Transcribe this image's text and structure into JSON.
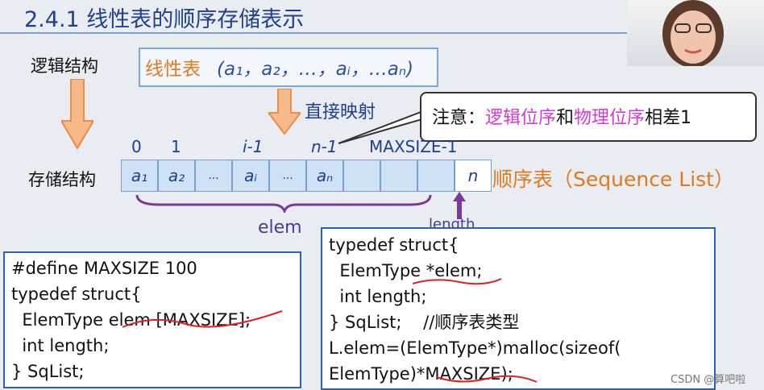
{
  "title": "2.4.1 线性表的顺序存储表示",
  "labels": {
    "logical": "逻辑结构",
    "storage": "存储结构",
    "direct_map": "直接映射"
  },
  "linear_table": {
    "title": "线性表",
    "sequence": "(a₁，a₂，…，aᵢ，…aₙ)"
  },
  "callout": {
    "prefix": "注意：",
    "hl1": "逻辑位序",
    "mid": "和",
    "hl2": "物理位序",
    "suffix": "相差1"
  },
  "indices": [
    "0",
    "1",
    "i-1",
    "n-1",
    "MAXSIZE-1"
  ],
  "cells": [
    "a₁",
    "a₂",
    "...",
    "aᵢ",
    "...",
    "aₙ",
    "",
    "",
    "",
    "n"
  ],
  "sequence_table_label": "顺序表（Sequence List）",
  "elem_label": "elem",
  "length_label": "length",
  "code_left": [
    "#define MAXSIZE 100",
    "typedef struct{",
    "  ElemType elem [MAXSIZE];",
    "  int length;",
    "} SqList;"
  ],
  "code_right": [
    "typedef struct{",
    "  ElemType *elem;",
    "  int length;",
    "} SqList;    //顺序表类型",
    "L.elem=(ElemType*)malloc(sizeof(",
    "ElemType)*MAXSIZE);"
  ],
  "watermark": "CSDN @算吧啦",
  "colors": {
    "title": "#1f3f8f",
    "orange": "#e07a20",
    "magenta": "#d23ad1",
    "code_border": "#2b63ad",
    "cell_fill": "#cfe1f5"
  }
}
